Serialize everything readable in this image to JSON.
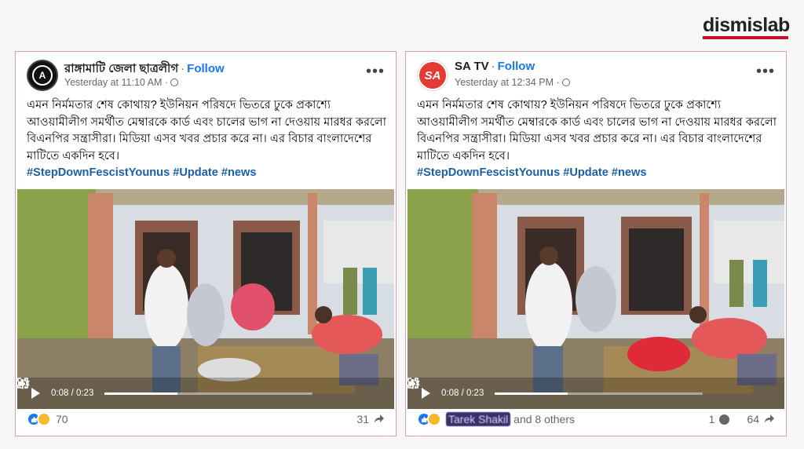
{
  "brand": {
    "logo_text": "dismislab",
    "accent": "#c8102e"
  },
  "posts": [
    {
      "page_name": "রাঙ্গামাটি জেলা ছাত্রলীগ",
      "follow_label": "Follow",
      "timestamp": "Yesterday at 11:10 AM",
      "body": "এমন নির্মমতার শেষ কোথায়? ইউনিয়ন পরিষদে ভিতরে ঢুকে প্রকাশ্যে আওয়ামীলীগ সমর্থীত মেম্বারকে কার্ড এবং চালের ভাগ না দেওয়ায় মারধর করলো বিএনপির সন্ত্রাসীরা। মিডিয়া এসব খবর প্রচার করে না। এর বিচার বাংলাদেশের মাটিতে একদিন হবে।",
      "hashtags": "#StepDownFescistYounus #Update #news",
      "video_time": "0:08 / 0:23",
      "video_progress": 0.35,
      "reactions_text": "70",
      "reactor_blurred": "",
      "comments_count": "",
      "shares_count": "31"
    },
    {
      "page_name": "SA TV",
      "follow_label": "Follow",
      "timestamp": "Yesterday at 12:34 PM",
      "body": "এমন নির্মমতার শেষ কোথায়? ইউনিয়ন পরিষদে ভিতরে ঢুকে প্রকাশ্যে আওয়ামীলীগ সমর্থীত মেম্বারকে কার্ড এবং চালের ভাগ না দেওয়ায় মারধর করলো বিএনপির সন্ত্রাসীরা। মিডিয়া এসব খবর প্রচার করে না। এর বিচার বাংলাদেশের মাটিতে একদিন হবে।",
      "hashtags": "#StepDownFescistYounus #Update #news",
      "video_time": "0:08 / 0:23",
      "video_progress": 0.35,
      "reactions_text": "and 8 others",
      "reactor_blurred": "Tarek Shakil",
      "comments_count": "1",
      "shares_count": "64"
    }
  ],
  "avatar_labels": {
    "left": "A",
    "right": "SA"
  }
}
